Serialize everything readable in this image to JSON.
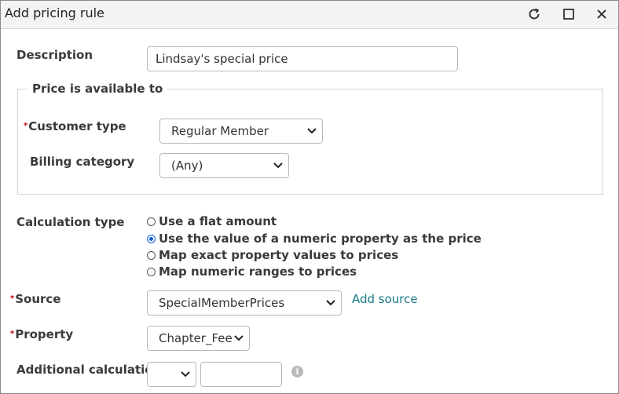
{
  "window": {
    "title": "Add pricing rule"
  },
  "description": {
    "label": "Description",
    "value": "Lindsay's special price"
  },
  "availability": {
    "legend": "Price is available to",
    "customer_type": {
      "label": "Customer type",
      "value": "Regular Member"
    },
    "billing_category": {
      "label": "Billing category",
      "value": "(Any)"
    }
  },
  "calculation": {
    "label": "Calculation type",
    "options": [
      {
        "label": "Use a flat amount",
        "checked": false
      },
      {
        "label": "Use the value of a numeric property as the price",
        "checked": true
      },
      {
        "label": "Map exact property values to prices",
        "checked": false
      },
      {
        "label": "Map numeric ranges to prices",
        "checked": false
      }
    ]
  },
  "source": {
    "label": "Source",
    "value": "SpecialMemberPrices",
    "add_link": "Add source"
  },
  "property": {
    "label": "Property",
    "value": "Chapter_Fee"
  },
  "additional": {
    "label": "Additional calculation",
    "operator": "",
    "amount": ""
  },
  "icons": {
    "refresh": "refresh-icon",
    "maximize": "maximize-icon",
    "close": "close-icon",
    "info": "info-icon",
    "required": "required-asterisk"
  },
  "colors": {
    "radio_checked": "#0a5cd6",
    "link": "#1a7a8a",
    "required": "#cc0000"
  }
}
